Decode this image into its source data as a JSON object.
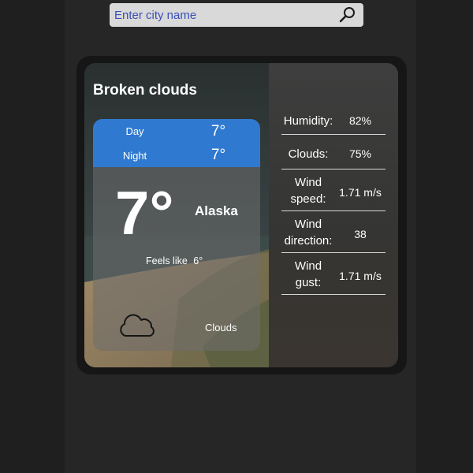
{
  "search": {
    "placeholder": "Enter city name"
  },
  "weather": {
    "title": "Broken clouds",
    "day_label": "Day",
    "day_temp": "7°",
    "night_label": "Night",
    "night_temp": "7°",
    "temp": "7°",
    "location": "Alaska",
    "feels_label": "Feels like",
    "feels_value": "6°",
    "description": "Clouds",
    "icon": "cloud-icon"
  },
  "stats": [
    {
      "label": "Humidity:",
      "value": "82%"
    },
    {
      "label": "Clouds:",
      "value": "75%"
    },
    {
      "label": "Wind speed:",
      "value": "1.71 m/s"
    },
    {
      "label": "Wind direction:",
      "value": "38"
    },
    {
      "label": "Wind gust:",
      "value": "1.71 m/s"
    }
  ],
  "colors": {
    "accent_blue": "#2f7ad0",
    "page_bg": "#1f1f1f"
  }
}
